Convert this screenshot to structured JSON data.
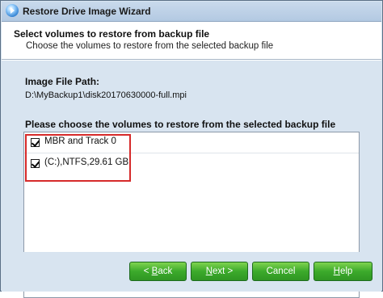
{
  "window": {
    "title": "Restore Drive Image Wizard"
  },
  "header": {
    "title": "Select volumes to restore from backup file",
    "subtitle": "Choose the volumes to restore from the selected backup file"
  },
  "image_file": {
    "label": "Image File Path:",
    "path": "D:\\MyBackup1\\disk20170630000-full.mpi"
  },
  "volumes": {
    "label": "Please choose the volumes to restore from the selected backup file",
    "items": [
      {
        "label": "MBR and Track 0",
        "checked": true
      },
      {
        "label": "(C:),NTFS,29.61 GB",
        "checked": true
      }
    ]
  },
  "buttons": {
    "back": {
      "prefix": "< ",
      "accel": "B",
      "rest": "ack"
    },
    "next": {
      "accel": "N",
      "rest": "ext >"
    },
    "cancel": {
      "label": "Cancel"
    },
    "help": {
      "accel": "H",
      "rest": "elp"
    }
  },
  "colors": {
    "button_green": "#3caa2b",
    "highlight_red": "#d62a2a",
    "dialog_background": "#d8e4f0"
  },
  "icons": {
    "app": "restore-wizard-icon",
    "checkbox": "checkbox-checked-icon"
  }
}
